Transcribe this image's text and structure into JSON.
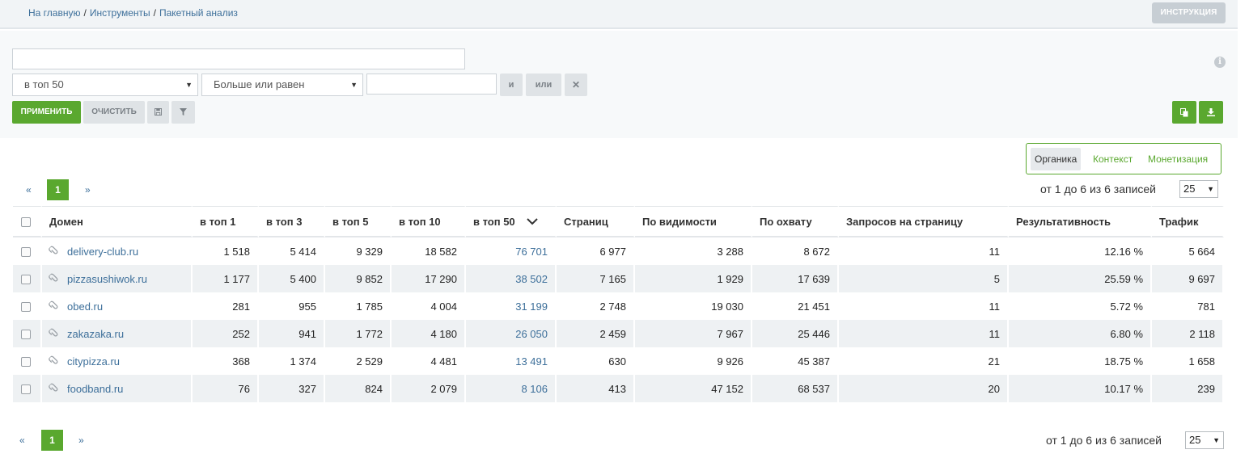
{
  "breadcrumb": {
    "home": "На главную",
    "tools": "Инструменты",
    "current": "Пакетный анализ",
    "sep": "/"
  },
  "header": {
    "instruction_label": "ИНСТРУКЦИЯ"
  },
  "filter": {
    "query_value": "",
    "field_select": "в топ 50",
    "operator_select": "Больше или равен",
    "value_input": "",
    "and_label": "и",
    "or_label": "или",
    "remove_label": "✕",
    "apply_label": "ПРИМЕНИТЬ",
    "clear_label": "ОЧИСТИТЬ",
    "info_icon": "i"
  },
  "tabs": {
    "organic": "Органика",
    "context": "Контекст",
    "monetization": "Монетизация",
    "active": "Органика"
  },
  "pagination": {
    "prev": "«",
    "next": "»",
    "current_page": "1",
    "records": "от 1 до 6 из 6 записей",
    "per_page": "25"
  },
  "table": {
    "headers": [
      "Домен",
      "в топ 1",
      "в топ 3",
      "в топ 5",
      "в топ 10",
      "в топ 50",
      "Страниц",
      "По видимости",
      "По охвату",
      "Запросов на страницу",
      "Результативность",
      "Трафик"
    ],
    "sorted_column": "в топ 50",
    "rows": [
      {
        "domain": "delivery-club.ru",
        "top1": "1 518",
        "top3": "5 414",
        "top5": "9 329",
        "top10": "18 582",
        "top50": "76 701",
        "pages": "6 977",
        "visibility": "3 288",
        "coverage": "8 672",
        "queries_per_page": "11",
        "efficiency": "12.16 %",
        "traffic": "5 664"
      },
      {
        "domain": "pizzasushiwok.ru",
        "top1": "1 177",
        "top3": "5 400",
        "top5": "9 852",
        "top10": "17 290",
        "top50": "38 502",
        "pages": "7 165",
        "visibility": "1 929",
        "coverage": "17 639",
        "queries_per_page": "5",
        "efficiency": "25.59 %",
        "traffic": "9 697"
      },
      {
        "domain": "obed.ru",
        "top1": "281",
        "top3": "955",
        "top5": "1 785",
        "top10": "4 004",
        "top50": "31 199",
        "pages": "2 748",
        "visibility": "19 030",
        "coverage": "21 451",
        "queries_per_page": "11",
        "efficiency": "5.72 %",
        "traffic": "781"
      },
      {
        "domain": "zakazaka.ru",
        "top1": "252",
        "top3": "941",
        "top5": "1 772",
        "top10": "4 180",
        "top50": "26 050",
        "pages": "2 459",
        "visibility": "7 967",
        "coverage": "25 446",
        "queries_per_page": "11",
        "efficiency": "6.80 %",
        "traffic": "2 118"
      },
      {
        "domain": "citypizza.ru",
        "top1": "368",
        "top3": "1 374",
        "top5": "2 529",
        "top10": "4 481",
        "top50": "13 491",
        "pages": "630",
        "visibility": "9 926",
        "coverage": "45 387",
        "queries_per_page": "21",
        "efficiency": "18.75 %",
        "traffic": "1 658"
      },
      {
        "domain": "foodband.ru",
        "top1": "76",
        "top3": "327",
        "top5": "824",
        "top10": "2 079",
        "top50": "8 106",
        "pages": "413",
        "visibility": "47 152",
        "coverage": "68 537",
        "queries_per_page": "20",
        "efficiency": "10.17 %",
        "traffic": "239"
      }
    ]
  },
  "colors": {
    "accent": "#5aa82f",
    "link": "#3d6f9a",
    "row_alt": "#eef1f3"
  },
  "icons": {
    "save": "save-icon",
    "filter": "filter-icon",
    "copy": "copy-icon",
    "download": "download-icon",
    "sort": "chevron-down-icon",
    "attach": "paperclip-icon"
  }
}
